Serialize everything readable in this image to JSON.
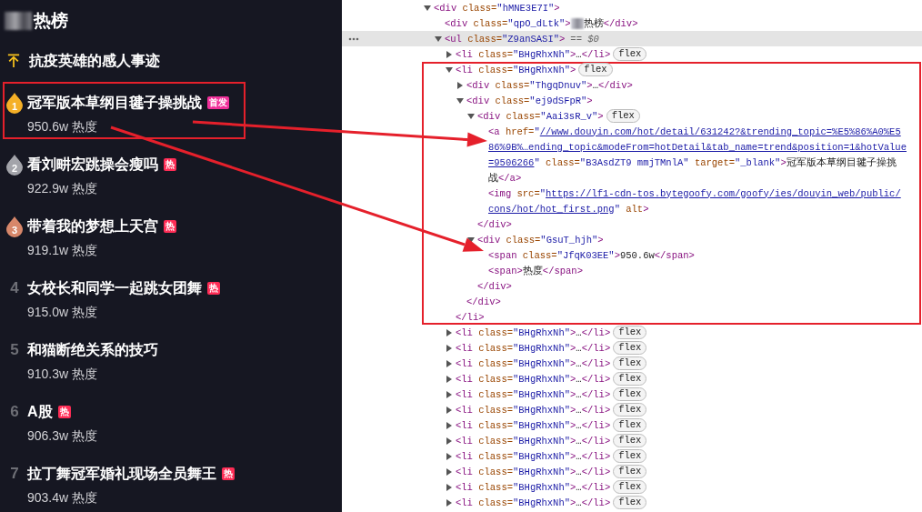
{
  "trending_panel": {
    "title": {
      "redacted": true,
      "text": "热榜"
    },
    "items": [
      {
        "kind": "pinned",
        "title": "抗疫英雄的感人事迹",
        "highlighted": false
      },
      {
        "kind": "medal",
        "rank": "1",
        "color": "#f5b027",
        "title": "冠军版本草纲目毽子操挑战",
        "tag": {
          "text": "首发",
          "color": "#f0309a"
        },
        "heat": "950.6w 热度",
        "highlighted": true
      },
      {
        "kind": "medal",
        "rank": "2",
        "color": "#a3a4aa",
        "title": "看刘畊宏跳操会瘦吗",
        "tag": {
          "text": "热",
          "color": "#fe2c55"
        },
        "heat": "922.9w 热度",
        "highlighted": false
      },
      {
        "kind": "medal",
        "rank": "3",
        "color": "#d7876a",
        "title": "带着我的梦想上天宫",
        "tag": {
          "text": "热",
          "color": "#fe2c55"
        },
        "heat": "919.1w 热度",
        "highlighted": false
      },
      {
        "kind": "plain",
        "rank": "4",
        "title": "女校长和同学一起跳女团舞",
        "tag": {
          "text": "热",
          "color": "#fe2c55"
        },
        "heat": "915.0w 热度",
        "highlighted": false
      },
      {
        "kind": "plain",
        "rank": "5",
        "title": "和猫断绝关系的技巧",
        "heat": "910.3w 热度",
        "highlighted": false
      },
      {
        "kind": "plain",
        "rank": "6",
        "title": "A股",
        "tag": {
          "text": "热",
          "color": "#fe2c55"
        },
        "heat": "906.3w 热度",
        "highlighted": false
      },
      {
        "kind": "plain",
        "rank": "7",
        "title": "拉丁舞冠军婚礼现场全员舞王",
        "tag": {
          "text": "热",
          "color": "#fe2c55"
        },
        "heat": "903.4w 热度",
        "highlighted": false
      }
    ]
  },
  "devtools": {
    "tree": [
      {
        "kind": "element",
        "text": "<div class=\"hMNE3E7I\">",
        "expanded": true,
        "selected": false,
        "highlighted": false,
        "children": [
          {
            "kind": "line",
            "text": "<div class=\"qpO_dLtk\">",
            "redacted": true,
            "tail": "热榜</div>",
            "selected": false,
            "highlighted": false
          },
          {
            "kind": "element",
            "text": "<ul class=\"Z9anSASI\">",
            "suffix": "== $0",
            "expanded": true,
            "selected": true,
            "highlighted": false,
            "children": [
              {
                "kind": "element",
                "text": "<li class=\"BHgRhxNh\">…</li>",
                "badge": "flex",
                "expanded": false,
                "selected": false,
                "highlighted": false
              },
              {
                "kind": "element",
                "text": "<li class=\"BHgRhxNh\">",
                "badge": "flex",
                "expanded": true,
                "selected": false,
                "highlighted": true,
                "close": "</li>",
                "children": [
                  {
                    "kind": "element",
                    "text": "<div class=\"ThgqDnuv\">…</div>",
                    "expanded": false,
                    "selected": false,
                    "highlighted": false
                  },
                  {
                    "kind": "element",
                    "text": "<div class=\"ej9dSFpR\">",
                    "expanded": true,
                    "selected": false,
                    "highlighted": false,
                    "close": "</div>",
                    "children": [
                      {
                        "kind": "element",
                        "text": "<div class=\"Aai3sR_v\">",
                        "badge": "flex",
                        "expanded": true,
                        "selected": false,
                        "highlighted": false,
                        "close": "</div>",
                        "children": [
                          {
                            "kind": "line",
                            "selected": false,
                            "highlighted": false,
                            "lines": [
                              [
                                {
                                  "kind": "tag",
                                  "text": "<a"
                                },
                                {
                                  "kind": "attr",
                                  "text": " href="
                                },
                                {
                                  "kind": "value",
                                  "text": "\""
                                },
                                {
                                  "kind": "link",
                                  "text": "//www.douyin.com/hot/detail/631242?&trending_topic=%E5%86%A0%E5"
                                }
                              ],
                              [
                                {
                                  "kind": "link",
                                  "text": "86%9B%…ending_topic&modeFrom=hotDetail&tab_name=trend&position=1&hotValue"
                                }
                              ],
                              [
                                {
                                  "kind": "link",
                                  "text": "=9506266"
                                },
                                {
                                  "kind": "value",
                                  "text": "\""
                                },
                                {
                                  "kind": "attr",
                                  "text": " class="
                                },
                                {
                                  "kind": "value",
                                  "text": "\"B3AsdZT9 mmjTMnlA\""
                                },
                                {
                                  "kind": "attr",
                                  "text": " target="
                                },
                                {
                                  "kind": "value",
                                  "text": "\"_blank\""
                                },
                                {
                                  "kind": "tag",
                                  "text": ">"
                                },
                                {
                                  "kind": "text",
                                  "text": "冠军版本草纲目毽子操挑"
                                }
                              ],
                              [
                                {
                                  "kind": "text",
                                  "text": "战"
                                },
                                {
                                  "kind": "tag",
                                  "text": "</a>"
                                }
                              ]
                            ]
                          },
                          {
                            "kind": "line",
                            "selected": false,
                            "highlighted": false,
                            "lines": [
                              [
                                {
                                  "kind": "tag",
                                  "text": "<img"
                                },
                                {
                                  "kind": "attr",
                                  "text": " src="
                                },
                                {
                                  "kind": "value",
                                  "text": "\""
                                },
                                {
                                  "kind": "link",
                                  "text": "https://lf1-cdn-tos.bytegoofy.com/goofy/ies/douyin_web/public/"
                                }
                              ],
                              [
                                {
                                  "kind": "link",
                                  "text": "cons/hot/hot_first.png"
                                },
                                {
                                  "kind": "value",
                                  "text": "\""
                                },
                                {
                                  "kind": "attr",
                                  "text": " alt"
                                },
                                {
                                  "kind": "tag",
                                  "text": ">"
                                }
                              ]
                            ]
                          }
                        ]
                      },
                      {
                        "kind": "element",
                        "text": "<div class=\"GsuT_hjh\">",
                        "expanded": true,
                        "selected": false,
                        "highlighted": false,
                        "close": "</div>",
                        "children": [
                          {
                            "kind": "line",
                            "text": "<span class=\"JfqK03EE\">950.6w</span>",
                            "selected": false,
                            "highlighted": false
                          },
                          {
                            "kind": "line",
                            "text": "<span>热度</span>",
                            "selected": false,
                            "highlighted": false
                          }
                        ]
                      }
                    ]
                  }
                ]
              },
              {
                "kind": "element",
                "text": "<li class=\"BHgRhxNh\">…</li>",
                "badge": "flex",
                "expanded": false,
                "selected": false,
                "highlighted": false
              },
              {
                "kind": "element",
                "text": "<li class=\"BHgRhxNh\">…</li>",
                "badge": "flex",
                "expanded": false,
                "selected": false,
                "highlighted": false
              },
              {
                "kind": "element",
                "text": "<li class=\"BHgRhxNh\">…</li>",
                "badge": "flex",
                "expanded": false,
                "selected": false,
                "highlighted": false
              },
              {
                "kind": "element",
                "text": "<li class=\"BHgRhxNh\">…</li>",
                "badge": "flex",
                "expanded": false,
                "selected": false,
                "highlighted": false
              },
              {
                "kind": "element",
                "text": "<li class=\"BHgRhxNh\">…</li>",
                "badge": "flex",
                "expanded": false,
                "selected": false,
                "highlighted": false
              },
              {
                "kind": "element",
                "text": "<li class=\"BHgRhxNh\">…</li>",
                "badge": "flex",
                "expanded": false,
                "selected": false,
                "highlighted": false
              },
              {
                "kind": "element",
                "text": "<li class=\"BHgRhxNh\">…</li>",
                "badge": "flex",
                "expanded": false,
                "selected": false,
                "highlighted": false
              },
              {
                "kind": "element",
                "text": "<li class=\"BHgRhxNh\">…</li>",
                "badge": "flex",
                "expanded": false,
                "selected": false,
                "highlighted": false
              },
              {
                "kind": "element",
                "text": "<li class=\"BHgRhxNh\">…</li>",
                "badge": "flex",
                "expanded": false,
                "selected": false,
                "highlighted": false
              },
              {
                "kind": "element",
                "text": "<li class=\"BHgRhxNh\">…</li>",
                "badge": "flex",
                "expanded": false,
                "selected": false,
                "highlighted": false
              },
              {
                "kind": "element",
                "text": "<li class=\"BHgRhxNh\">…</li>",
                "badge": "flex",
                "expanded": false,
                "selected": false,
                "highlighted": false
              },
              {
                "kind": "element",
                "text": "<li class=\"BHgRhxNh\">…</li>",
                "badge": "flex",
                "expanded": false,
                "selected": false,
                "highlighted": false
              }
            ]
          }
        ]
      }
    ]
  }
}
